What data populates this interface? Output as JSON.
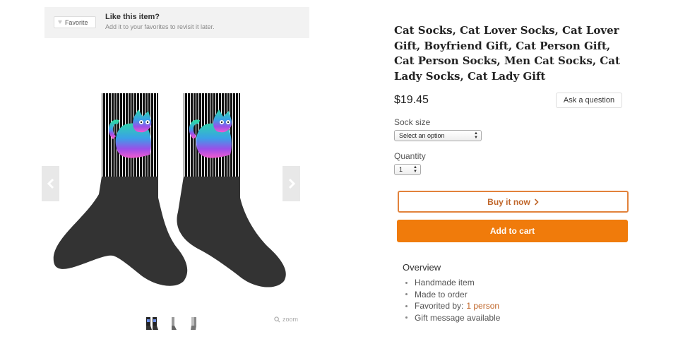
{
  "favorite_banner": {
    "button_label": "Favorite",
    "title": "Like this item?",
    "subtitle": "Add it to your favorites to revisit it later."
  },
  "gallery": {
    "zoom_label": "zoom",
    "thumbnail_count": 3
  },
  "product": {
    "title": "Cat Socks, Cat Lover Socks, Cat Lover Gift, Boyfriend Gift, Cat Person Gift, Cat Person Socks, Men Cat Socks, Cat Lady Socks, Cat Lady Gift",
    "price": "$19.45",
    "ask_question_label": "Ask a question"
  },
  "options": {
    "sock_size_label": "Sock size",
    "sock_size_value": "Select an option",
    "quantity_label": "Quantity",
    "quantity_value": "1"
  },
  "actions": {
    "buy_now_label": "Buy it now",
    "add_to_cart_label": "Add to cart"
  },
  "overview": {
    "title": "Overview",
    "items": [
      {
        "text": "Handmade item"
      },
      {
        "text": "Made to order"
      },
      {
        "text": "Favorited by:",
        "link": "1 person"
      },
      {
        "text": "Gift message available"
      }
    ]
  },
  "colors": {
    "accent_orange": "#f07b0b",
    "link_orange": "#c0662a",
    "sock_black": "#333333"
  }
}
